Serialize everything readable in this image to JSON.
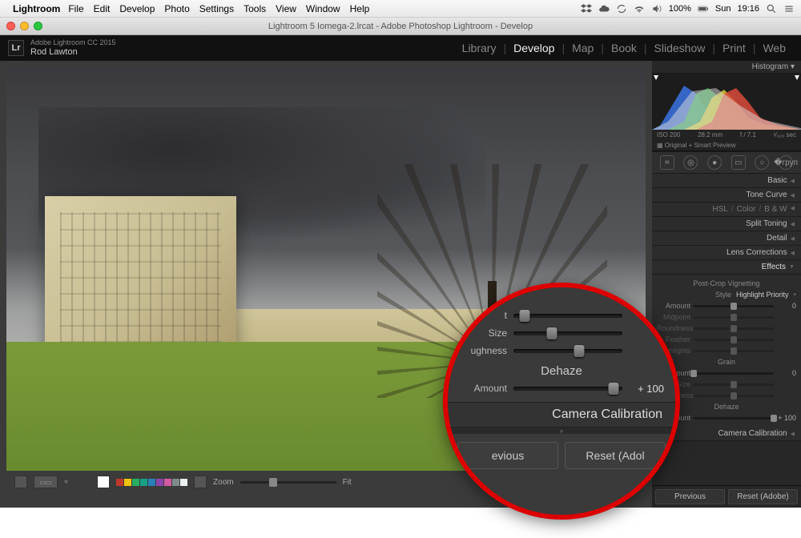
{
  "mac_menu": {
    "apple": "",
    "app": "Lightroom",
    "items": [
      "File",
      "Edit",
      "Develop",
      "Photo",
      "Settings",
      "Tools",
      "View",
      "Window",
      "Help"
    ],
    "status": {
      "battery": "100%",
      "charging": "⚡",
      "day": "Sun",
      "time": "19:16"
    }
  },
  "window": {
    "title": "Lightroom 5 Iomega-2.lrcat - Adobe Photoshop Lightroom - Develop"
  },
  "header": {
    "logo": "Lr",
    "brand1": "Adobe Lightroom CC 2015",
    "brand2": "Rod Lawton",
    "modules": [
      "Library",
      "Develop",
      "Map",
      "Book",
      "Slideshow",
      "Print",
      "Web"
    ],
    "active_module": "Develop"
  },
  "histogram": {
    "title": "Histogram",
    "iso": "ISO 200",
    "focal": "28.2 mm",
    "aperture": "f / 7.1",
    "shutter": "¹⁄₄₂₀ sec",
    "sub": "Original + Smart Preview"
  },
  "panels": {
    "basic": "Basic",
    "tonecurve": "Tone Curve",
    "hsl": {
      "hsl": "HSL",
      "color": "Color",
      "bw": "B & W"
    },
    "split": "Split Toning",
    "detail": "Detail",
    "lens": "Lens Corrections",
    "effects": "Effects",
    "calibration": "Camera Calibration"
  },
  "effects": {
    "vignette_title": "Post-Crop Vignetting",
    "style_label": "Style",
    "style_value": "Highlight Priority",
    "sliders": [
      {
        "label": "Amount",
        "value": "0",
        "pos": 50
      },
      {
        "label": "Midpoint",
        "value": "",
        "pos": 50,
        "dim": true
      },
      {
        "label": "Roundness",
        "value": "",
        "pos": 50,
        "dim": true
      },
      {
        "label": "Feather",
        "value": "",
        "pos": 50,
        "dim": true
      },
      {
        "label": "Highlights",
        "value": "",
        "pos": 50,
        "dim": true
      }
    ],
    "grain_title": "Grain",
    "grain_sliders": [
      {
        "label": "Amount",
        "value": "0",
        "pos": 0
      },
      {
        "label": "Size",
        "value": "",
        "pos": 50,
        "dim": true
      },
      {
        "label": "Roughness",
        "value": "",
        "pos": 50,
        "dim": true
      }
    ],
    "dehaze_title": "Dehaze",
    "dehaze": {
      "label": "Amount",
      "value": "+ 100",
      "pos": 100
    }
  },
  "footer": {
    "previous": "Previous",
    "reset": "Reset (Adobe)"
  },
  "bottom": {
    "zoom_label": "Zoom",
    "fit_label": "Fit"
  },
  "magnifier": {
    "rows": [
      {
        "label": "t",
        "pos": 10,
        "val": ""
      },
      {
        "label": "Size",
        "pos": 35,
        "val": ""
      },
      {
        "label": "ughness",
        "pos": 60,
        "val": ""
      }
    ],
    "dehaze_title": "Dehaze",
    "dehaze": {
      "label": "Amount",
      "pos": 92,
      "val": "+ 100"
    },
    "calibration": "Camera Calibration",
    "prev": "evious",
    "reset": "Reset (Adol"
  }
}
